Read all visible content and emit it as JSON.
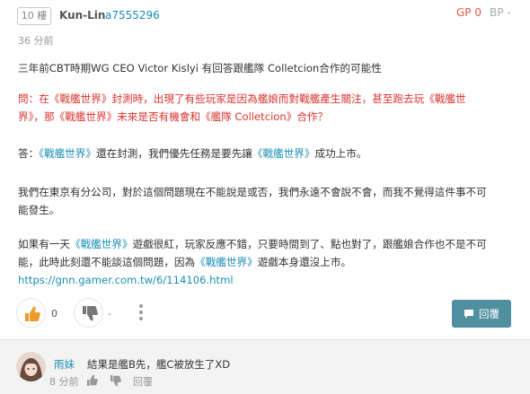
{
  "post": {
    "floor": "10 樓",
    "username": "Kun-Lin",
    "user_id": "a7555296",
    "gp_label": "GP 0",
    "bp_label": "BP -",
    "time": "36 分前",
    "paragraphs": {
      "intro": "三年前CBT時期WG CEO Victor Kislyi 有回答跟艦隊 Colletcion合作的可能性",
      "q1_prefix": "問：在",
      "q1_game": "《戰艦世界》",
      "q1_mid": "封測時，出現了有些玩家是因為艦娘而對戰艦產生關注，甚至跑去玩",
      "q1_game2": "《戰艦世",
      "q2_game2_end": "界》",
      "q2_mid": "，那",
      "q2_game3": "《戰艦世界》",
      "q2_mid2": "未來是否有機會和",
      "q2_game4": "《艦隊 Colletcion》",
      "q2_end": "合作？",
      "a1_prefix": "答：",
      "a1_game": "《戰艦世界》",
      "a1_mid": "還在封測，我們優先任務是要先讓",
      "a1_game2": "《戰艦世界》",
      "a1_end": "成功上市。",
      "p3_line1": "我們在東京有分公司，對於這個問題現在不能說是或否，我們永遠不會說不會，而我不覺得這件事不可",
      "p3_line2": "能發生。",
      "p4_start": "如果有一天",
      "p4_game": "《戰艦世界》",
      "p4_mid": "遊戲很紅，玩家反應不錯，只要時間到了、點也對了，跟艦娘合作也不是不可",
      "p4_line2_start": "能，此時此刻還不能談這個問題，因為",
      "p4_game2": "《戰艦世界》",
      "p4_line2_end": "遊戲本身還沒上市。",
      "link": "https://gnn.gamer.com.tw/6/114106.html"
    },
    "actions": {
      "gp_count": "0",
      "bp_count": "-",
      "reply_label": "回覆"
    }
  },
  "comment": {
    "username": "雨妹",
    "text": "結果是艦B先，艦C被放生了XD",
    "time": "8 分前",
    "reply_label": "回覆"
  },
  "colors": {
    "accent_blue": "#1a8fb5",
    "question_red": "#d9332e",
    "gp_orange": "#e9584b",
    "reply_button": "#4f8fa0"
  },
  "icons": [
    "thumbs-up-icon",
    "thumbs-down-icon",
    "more-vertical-icon",
    "reply-chat-icon"
  ]
}
